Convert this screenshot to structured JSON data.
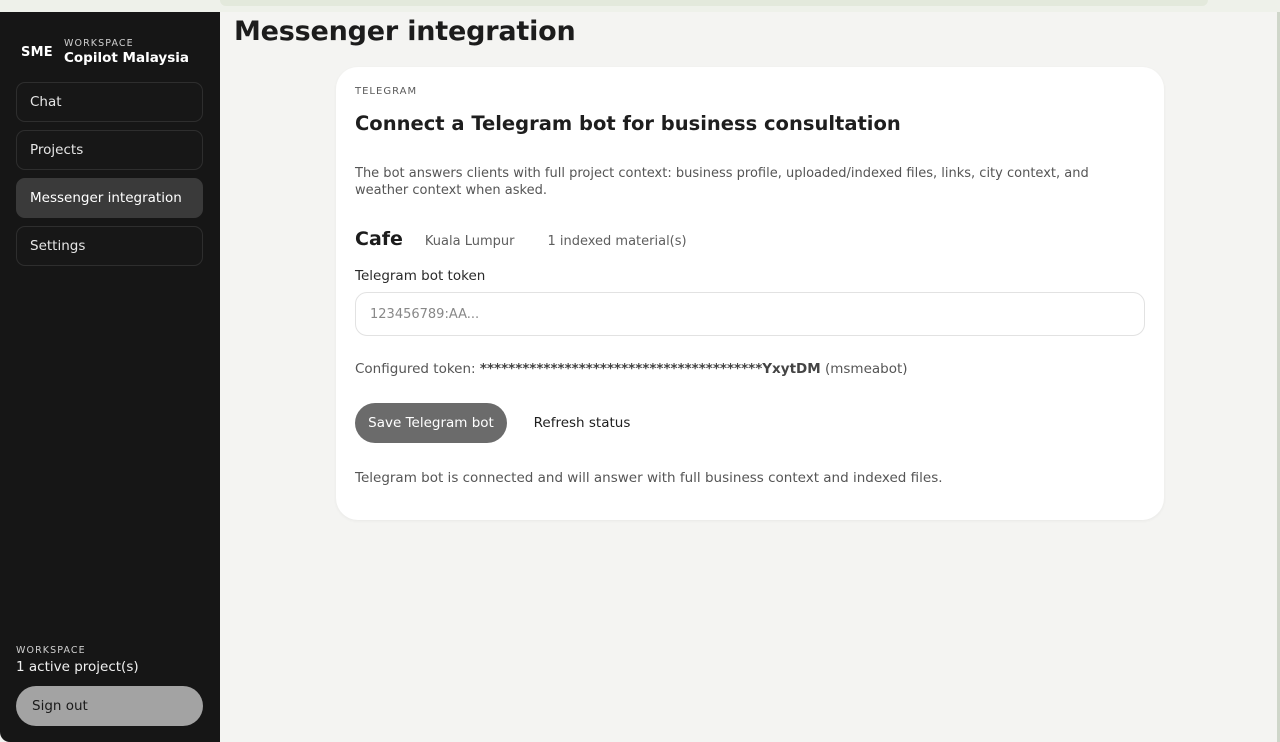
{
  "sidebar": {
    "brand_mark": "SME",
    "workspace_label": "WORKSPACE",
    "workspace_name": "Copilot Malaysia",
    "items": [
      {
        "label": "Chat",
        "active": false
      },
      {
        "label": "Projects",
        "active": false
      },
      {
        "label": "Messenger integration",
        "active": true
      },
      {
        "label": "Settings",
        "active": false
      }
    ],
    "footer_label": "WORKSPACE",
    "footer_count": "1 active project(s)",
    "sign_out": "Sign out"
  },
  "page": {
    "title": "Messenger integration"
  },
  "card": {
    "eyebrow": "TELEGRAM",
    "title": "Connect a Telegram bot for business consultation",
    "description": "The bot answers clients with full project context: business profile, uploaded/indexed files, links, city context, and weather context when asked.",
    "project_name": "Cafe",
    "project_city": "Kuala Lumpur",
    "project_materials": "1 indexed material(s)",
    "token_label": "Telegram bot token",
    "token_placeholder": "123456789:AA...",
    "token_value": "",
    "configured_prefix": "Configured token:",
    "configured_masked": "****************************************YxytDM",
    "configured_bot": "(msmeabot)",
    "save_button": "Save Telegram bot",
    "refresh_button": "Refresh status",
    "status_text": "Telegram bot is connected and will answer with full business context and indexed files."
  },
  "colors": {
    "sidebar_bg": "#161616",
    "active_item": "#3a3a3a",
    "page_bg": "#f4f4f2",
    "primary_button": "#6b6b6b"
  }
}
